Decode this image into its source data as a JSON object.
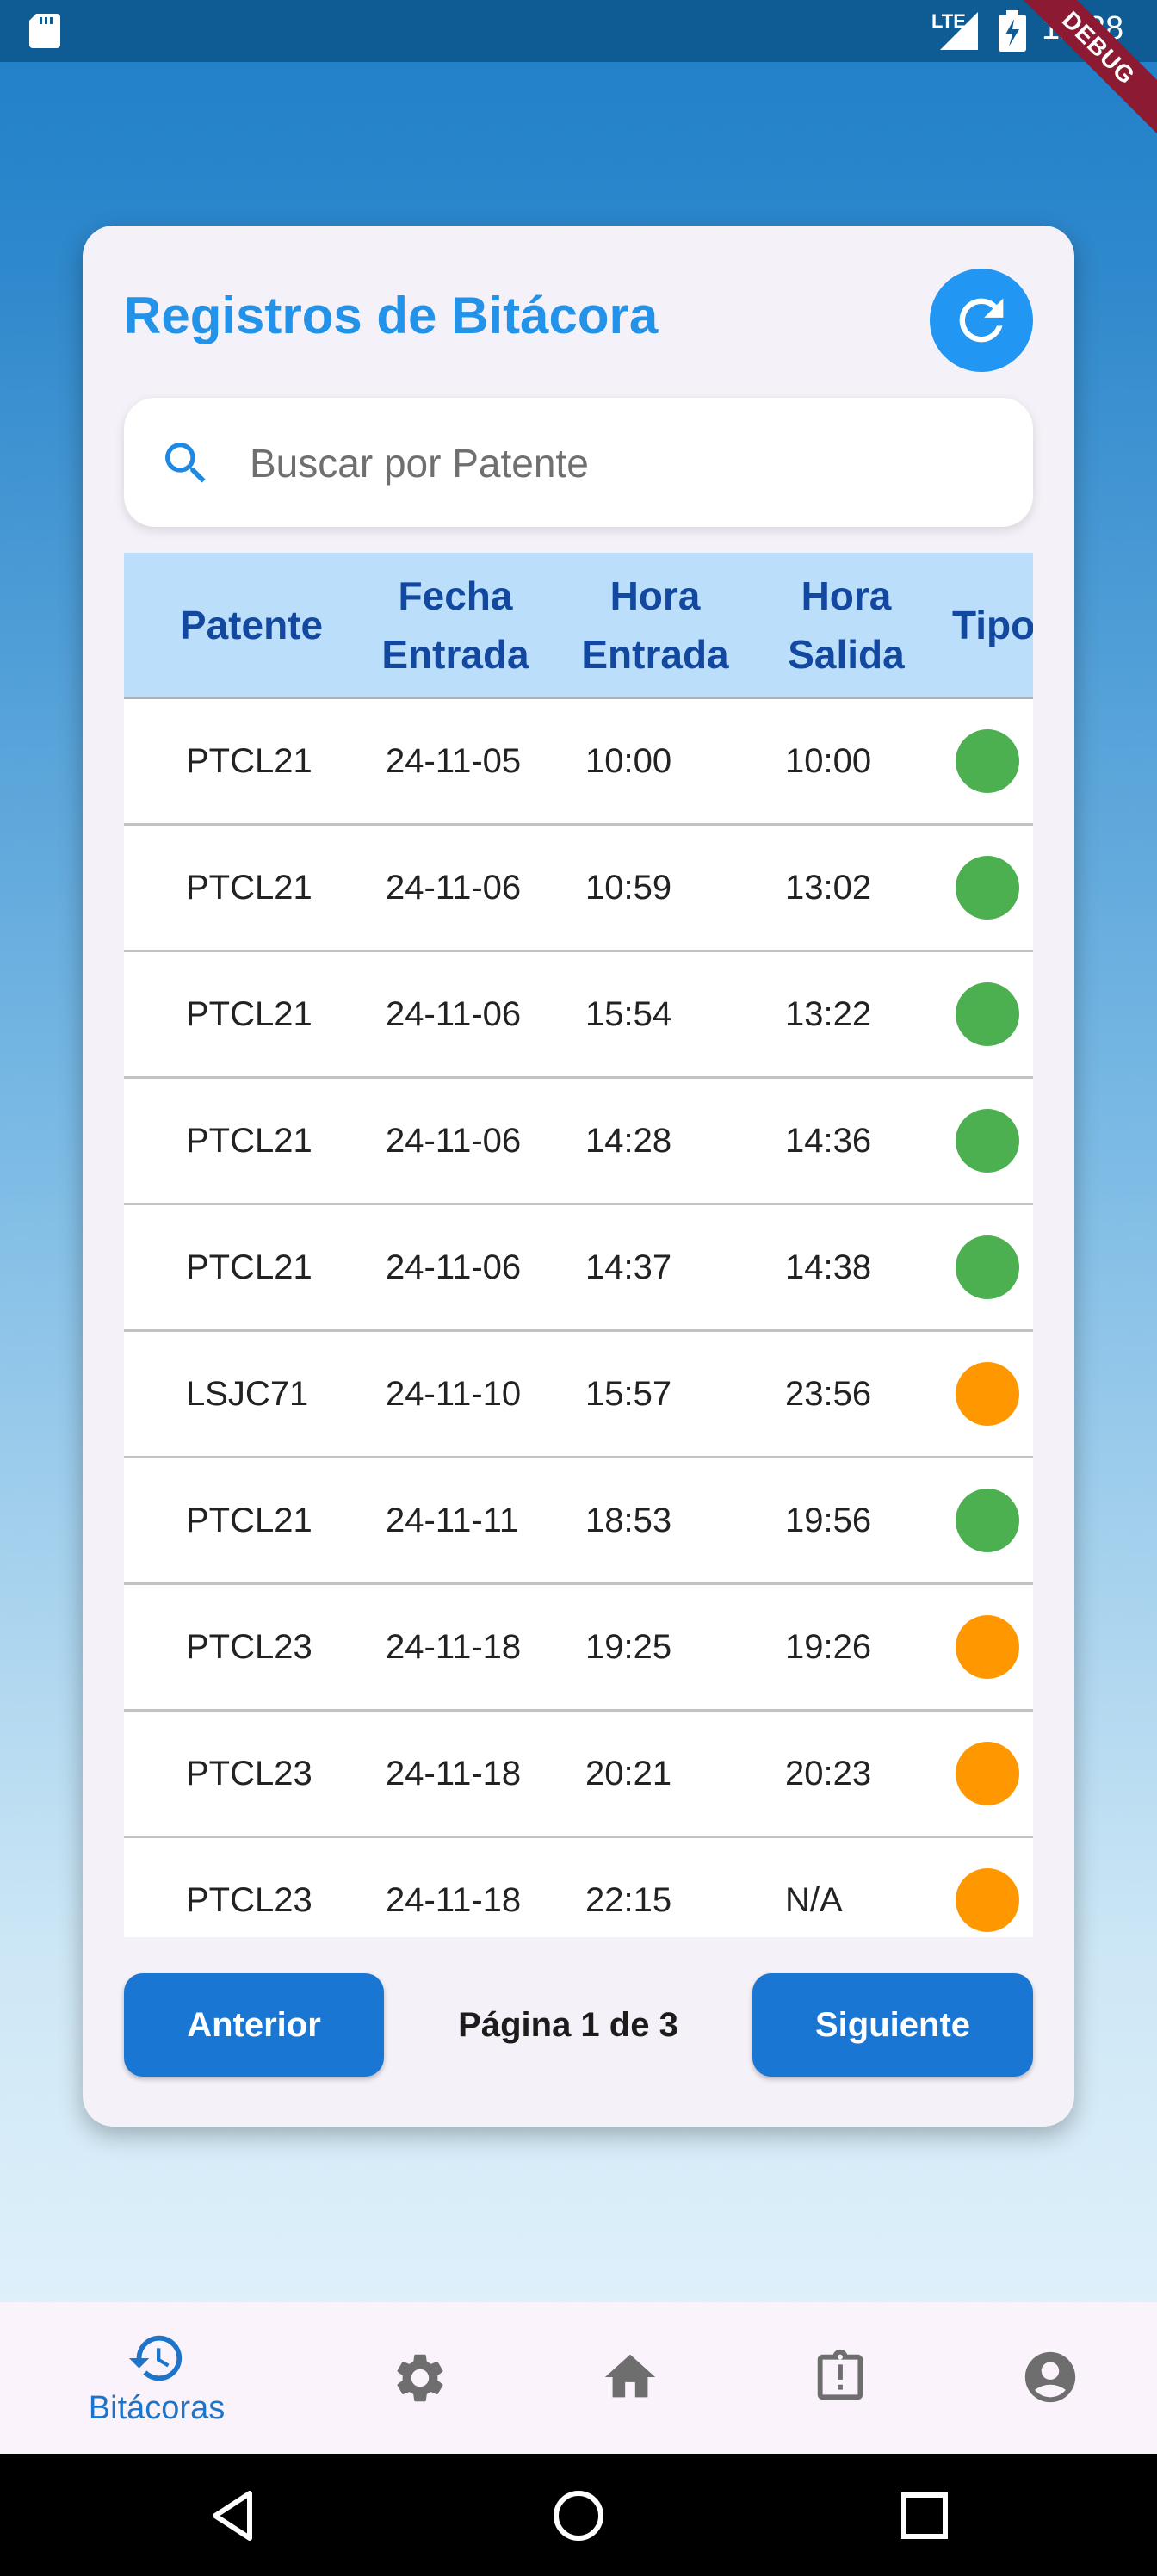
{
  "status_bar": {
    "time": "12:28",
    "network": "LTE",
    "debug_label": "DEBUG"
  },
  "card": {
    "title": "Registros de Bitácora",
    "refresh_icon": "refresh-icon",
    "search": {
      "placeholder": "Buscar por Patente",
      "value": "",
      "icon": "search-icon"
    }
  },
  "table": {
    "headers": [
      "Patente",
      "Fecha\nEntrada",
      "Hora\nEntrada",
      "Hora\nSalida",
      "Tipo"
    ],
    "rows": [
      {
        "patente": "PTCL21",
        "fecha": "24-11-05",
        "entrada": "10:00",
        "salida": "10:00",
        "tipo_color": "#4caf50"
      },
      {
        "patente": "PTCL21",
        "fecha": "24-11-06",
        "entrada": "10:59",
        "salida": "13:02",
        "tipo_color": "#4caf50"
      },
      {
        "patente": "PTCL21",
        "fecha": "24-11-06",
        "entrada": "15:54",
        "salida": "13:22",
        "tipo_color": "#4caf50"
      },
      {
        "patente": "PTCL21",
        "fecha": "24-11-06",
        "entrada": "14:28",
        "salida": "14:36",
        "tipo_color": "#4caf50"
      },
      {
        "patente": "PTCL21",
        "fecha": "24-11-06",
        "entrada": "14:37",
        "salida": "14:38",
        "tipo_color": "#4caf50"
      },
      {
        "patente": "LSJC71",
        "fecha": "24-11-10",
        "entrada": "15:57",
        "salida": "23:56",
        "tipo_color": "#ff9800"
      },
      {
        "patente": "PTCL21",
        "fecha": "24-11-11",
        "entrada": "18:53",
        "salida": "19:56",
        "tipo_color": "#4caf50"
      },
      {
        "patente": "PTCL23",
        "fecha": "24-11-18",
        "entrada": "19:25",
        "salida": "19:26",
        "tipo_color": "#ff9800"
      },
      {
        "patente": "PTCL23",
        "fecha": "24-11-18",
        "entrada": "20:21",
        "salida": "20:23",
        "tipo_color": "#ff9800"
      },
      {
        "patente": "PTCL23",
        "fecha": "24-11-18",
        "entrada": "22:15",
        "salida": "N/A",
        "tipo_color": "#ff9800"
      }
    ]
  },
  "pagination": {
    "prev_label": "Anterior",
    "page_label": "Página 1 de 3",
    "next_label": "Siguiente"
  },
  "bottom_nav": {
    "items": [
      {
        "label": "Bitácoras",
        "icon": "history-icon",
        "active": true
      },
      {
        "label": "",
        "icon": "settings-icon",
        "active": false
      },
      {
        "label": "",
        "icon": "home-icon",
        "active": false
      },
      {
        "label": "",
        "icon": "report-icon",
        "active": false
      },
      {
        "label": "",
        "icon": "account-icon",
        "active": false
      }
    ]
  },
  "colors": {
    "accent": "#2196f3",
    "button": "#1976d2",
    "header_bg": "#bbdefb",
    "header_text": "#1348a0",
    "status_green": "#4caf50",
    "status_orange": "#ff9800",
    "nav_active": "#1d74c8",
    "nav_inactive": "#6e6e6e"
  }
}
